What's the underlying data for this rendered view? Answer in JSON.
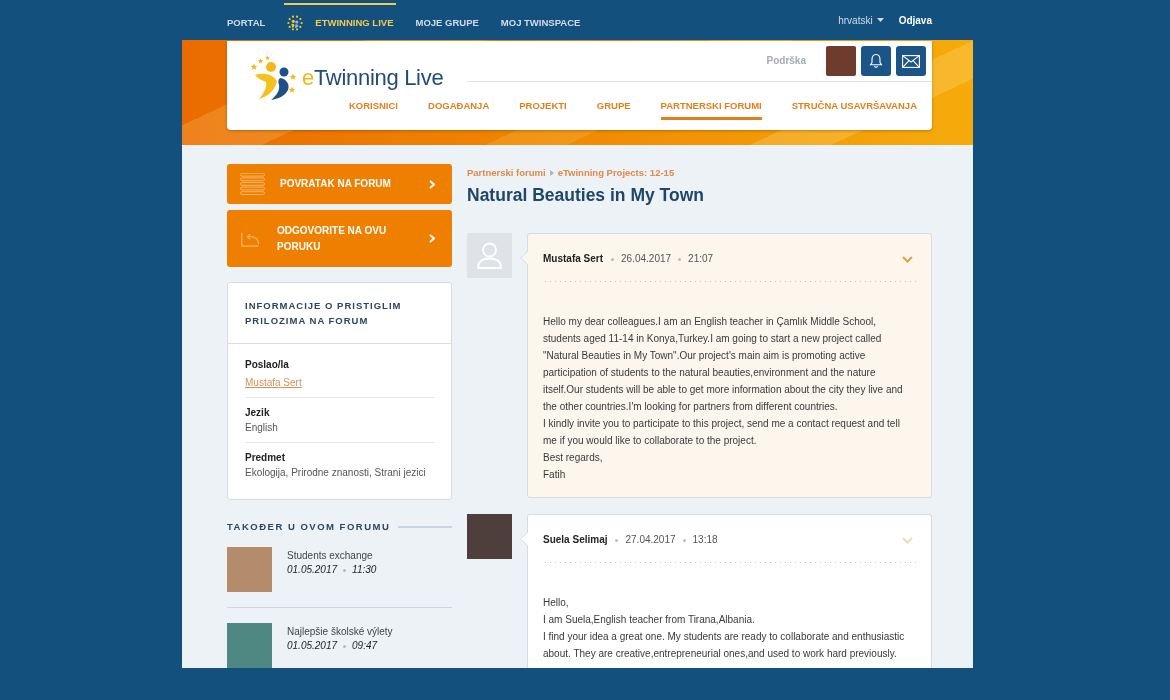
{
  "top_nav": {
    "items": [
      {
        "label": "PORTAL",
        "kind": "text",
        "selected": false
      },
      {
        "label": "ETWINNING LIVE",
        "kind": "logo",
        "selected": true
      },
      {
        "label": "MOJE GRUPE",
        "kind": "text",
        "selected": false
      },
      {
        "label": "MOJ TWINSPACE",
        "kind": "text",
        "selected": false
      }
    ],
    "language": "hrvatski",
    "logout": "Odjava"
  },
  "header": {
    "logo": {
      "accent": "e",
      "rest": "Twinning Live"
    },
    "support": "Podrška",
    "nav": [
      {
        "label": "KORISNICI",
        "selected": false
      },
      {
        "label": "DOGAĐANJA",
        "selected": false
      },
      {
        "label": "PROJEKTI",
        "selected": false
      },
      {
        "label": "GRUPE",
        "selected": false
      },
      {
        "label": "PARTNERSKI FORUMI",
        "selected": true
      },
      {
        "label": "STRUČNA USAVRŠAVANJA",
        "selected": false
      }
    ]
  },
  "sidebar": {
    "actions": [
      {
        "label": "POVRATAK NA FORUM",
        "kind": "list"
      },
      {
        "label": "ODGOVORITE NA OVU PORUKU",
        "kind": "reply"
      }
    ],
    "info": {
      "title": "INFORMACIJE O PRISTIGLIM PRILOZIMA NA FORUM",
      "fields": [
        {
          "label": "Poslao/la",
          "value": "Mustafa Sert",
          "kind": "link"
        },
        {
          "label": "Jezik",
          "value": "English",
          "kind": "text"
        },
        {
          "label": "Predmet",
          "value": "Ekologija, Prirodne znanosti, Strani jezici",
          "kind": "text"
        }
      ]
    },
    "related": {
      "title": "TAKOĐER U OVOM FORUMU",
      "items": [
        {
          "title": "Students exchange",
          "date": "01.05.2017",
          "time": "11:30"
        },
        {
          "title": "Najlepšie školské výlety",
          "date": "01.05.2017",
          "time": "09:47"
        }
      ]
    }
  },
  "thread": {
    "breadcrumb": [
      "Partnerski forumi",
      "eTwinning Projects: 12-15"
    ],
    "title": "Natural Beauties in My Town",
    "posts": [
      {
        "author": "Mustafa Sert",
        "date": "26.04.2017",
        "time": "21:07",
        "kind": "silhouette",
        "highlighted": true,
        "paragraphs": [
          "Hello my dear colleagues.I am an English teacher in Çamlık Middle School, students aged 11-14 in Konya,Turkey.I am going to start a new project called \"Natural Beauties in My Town\".Our project's main aim is promoting active participation of students to the natural beauties,environment and the nature itself.Our students will be able to get more information about the city they live and the other countries.I'm looking for partners from different countries.",
          "I kindly invite you to participate to this project, send me a contact request and tell me if you would like to collaborate to the project.",
          "Best regards,",
          "Fatih"
        ]
      },
      {
        "author": "Suela Selimaj",
        "date": "27.04.2017",
        "time": "13:18",
        "kind": "photo",
        "highlighted": false,
        "paragraphs": [
          "Hello,",
          "I am Suela,English teacher from Tirana,Albania.",
          "I find your idea a great one. My students are ready to collaborate and enthusiastic about. They are creative,entrepreneurial ones,and used to work hard previously."
        ]
      }
    ]
  }
}
